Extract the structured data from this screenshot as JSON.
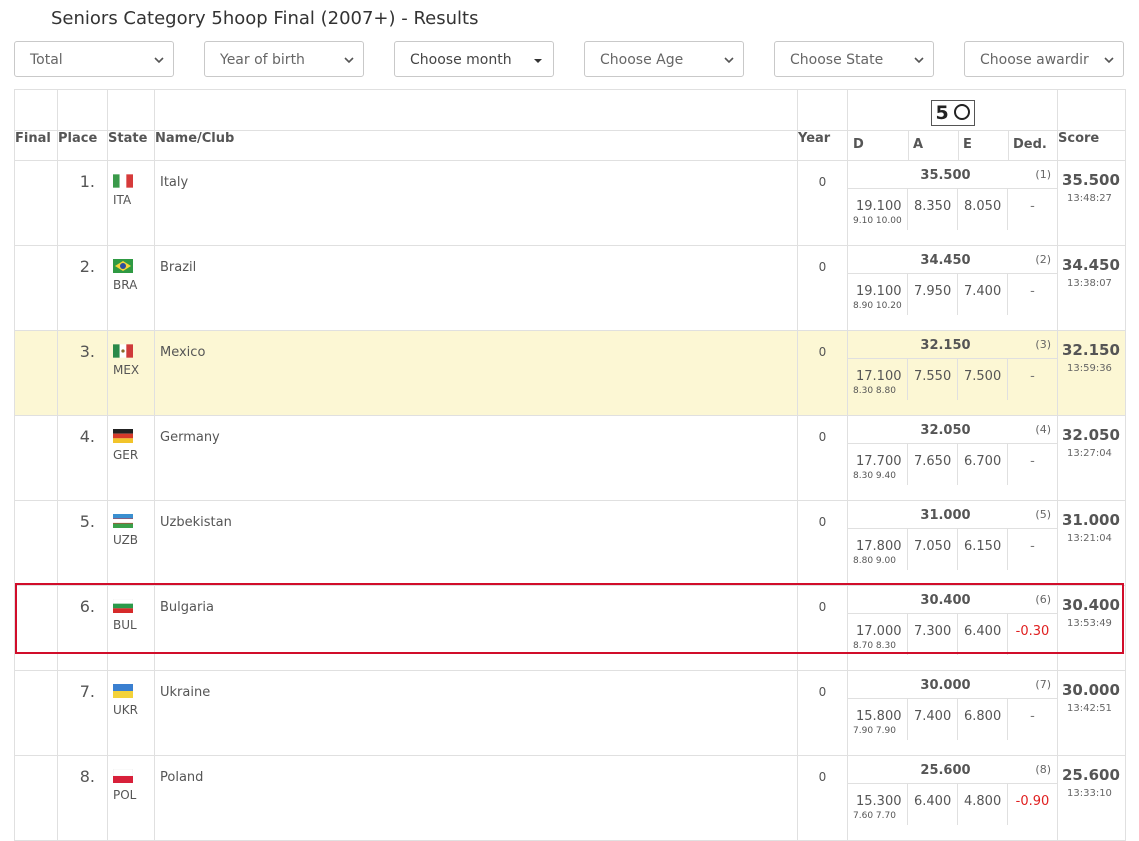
{
  "page": {
    "title": "Seniors Category 5hoop Final (2007+) - Results"
  },
  "filters": [
    {
      "label": "Total",
      "kind": "select"
    },
    {
      "label": "Year of birth",
      "kind": "select"
    },
    {
      "label": "Choose month",
      "kind": "dropdown"
    },
    {
      "label": "Choose Age",
      "kind": "select"
    },
    {
      "label": "Choose State",
      "kind": "select"
    },
    {
      "label": "Choose awardir",
      "kind": "select"
    }
  ],
  "apparatus": {
    "number": "5",
    "icon": "hoop-icon"
  },
  "columns": {
    "final": "Final",
    "place": "Place",
    "state": "State",
    "name": "Name/Club",
    "year": "Year",
    "d": "D",
    "a": "A",
    "e": "E",
    "ded": "Ded.",
    "score": "Score"
  },
  "rows": [
    {
      "place": "1.",
      "code": "ITA",
      "name": "Italy",
      "year": "0",
      "total": "35.500",
      "rank": "(1)",
      "d": "19.100",
      "dsub": "9.10 10.00",
      "a": "8.350",
      "e": "8.050",
      "ded": "-",
      "score": "35.500",
      "time": "13:48:27"
    },
    {
      "place": "2.",
      "code": "BRA",
      "name": "Brazil",
      "year": "0",
      "total": "34.450",
      "rank": "(2)",
      "d": "19.100",
      "dsub": "8.90 10.20",
      "a": "7.950",
      "e": "7.400",
      "ded": "-",
      "score": "34.450",
      "time": "13:38:07"
    },
    {
      "place": "3.",
      "code": "MEX",
      "name": "Mexico",
      "year": "0",
      "total": "32.150",
      "rank": "(3)",
      "d": "17.100",
      "dsub": "8.30 8.80",
      "a": "7.550",
      "e": "7.500",
      "ded": "-",
      "score": "32.150",
      "time": "13:59:36"
    },
    {
      "place": "4.",
      "code": "GER",
      "name": "Germany",
      "year": "0",
      "total": "32.050",
      "rank": "(4)",
      "d": "17.700",
      "dsub": "8.30 9.40",
      "a": "7.650",
      "e": "6.700",
      "ded": "-",
      "score": "32.050",
      "time": "13:27:04"
    },
    {
      "place": "5.",
      "code": "UZB",
      "name": "Uzbekistan",
      "year": "0",
      "total": "31.000",
      "rank": "(5)",
      "d": "17.800",
      "dsub": "8.80 9.00",
      "a": "7.050",
      "e": "6.150",
      "ded": "-",
      "score": "31.000",
      "time": "13:21:04"
    },
    {
      "place": "6.",
      "code": "BUL",
      "name": "Bulgaria",
      "year": "0",
      "total": "30.400",
      "rank": "(6)",
      "d": "17.000",
      "dsub": "8.70 8.30",
      "a": "7.300",
      "e": "6.400",
      "ded": "-0.30",
      "score": "30.400",
      "time": "13:53:49"
    },
    {
      "place": "7.",
      "code": "UKR",
      "name": "Ukraine",
      "year": "0",
      "total": "30.000",
      "rank": "(7)",
      "d": "15.800",
      "dsub": "7.90 7.90",
      "a": "7.400",
      "e": "6.800",
      "ded": "-",
      "score": "30.000",
      "time": "13:42:51"
    },
    {
      "place": "8.",
      "code": "POL",
      "name": "Poland",
      "year": "0",
      "total": "25.600",
      "rank": "(8)",
      "d": "15.300",
      "dsub": "7.60 7.70",
      "a": "6.400",
      "e": "4.800",
      "ded": "-0.90",
      "score": "25.600",
      "time": "13:33:10"
    }
  ],
  "colors": {
    "highlight_row": "#fcf7d4",
    "selection_border": "#d10d2a",
    "negative_deduction": "#e02020"
  }
}
